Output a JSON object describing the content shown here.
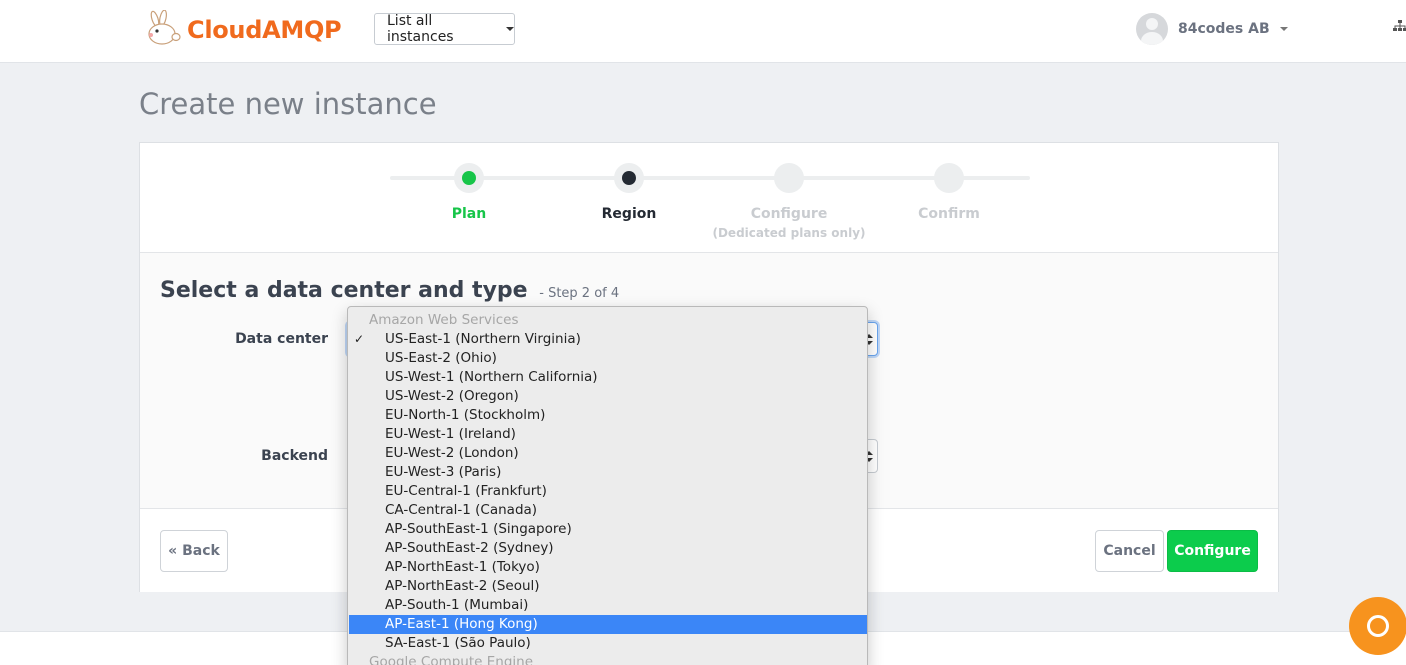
{
  "header": {
    "logo_text": "CloudAMQP",
    "instances_menu_label": "List all instances",
    "account_name": "84codes AB"
  },
  "page": {
    "title": "Create new instance"
  },
  "steps": [
    {
      "label": "Plan",
      "sub": "",
      "state": "done"
    },
    {
      "label": "Region",
      "sub": "",
      "state": "current"
    },
    {
      "label": "Configure",
      "sub": "(Dedicated plans only)",
      "state": "pending"
    },
    {
      "label": "Confirm",
      "sub": "",
      "state": "pending"
    }
  ],
  "form": {
    "section_title": "Select a data center and type",
    "section_step": "- Step 2 of 4",
    "data_center_label": "Data center",
    "backend_label": "Backend"
  },
  "buttons": {
    "back": "« Back",
    "cancel": "Cancel",
    "configure": "Configure"
  },
  "dropdown": {
    "group_aws": "Amazon Web Services",
    "group_gce": "Google Compute Engine",
    "selected_index": 0,
    "highlighted_index": 15,
    "options": [
      "US-East-1 (Northern Virginia)",
      "US-East-2 (Ohio)",
      "US-West-1 (Northern California)",
      "US-West-2 (Oregon)",
      "EU-North-1 (Stockholm)",
      "EU-West-1 (Ireland)",
      "EU-West-2 (London)",
      "EU-West-3 (Paris)",
      "EU-Central-1 (Frankfurt)",
      "CA-Central-1 (Canada)",
      "AP-SouthEast-1 (Singapore)",
      "AP-SouthEast-2 (Sydney)",
      "AP-NorthEast-1 (Tokyo)",
      "AP-NorthEast-2 (Seoul)",
      "AP-South-1 (Mumbai)",
      "AP-East-1 (Hong Kong)",
      "SA-East-1 (São Paulo)"
    ]
  },
  "colors": {
    "brand": "#f06a1d",
    "step_done": "#17c549",
    "step_current": "#242a33",
    "primary_button": "#0ccc4c",
    "highlight": "#3b86f7",
    "help_button": "#f7931e"
  },
  "icons": {
    "logo": "rabbit-logo-icon",
    "network": "network-tree-icon",
    "help": "chat-help-icon",
    "check": "checkmark-icon"
  }
}
